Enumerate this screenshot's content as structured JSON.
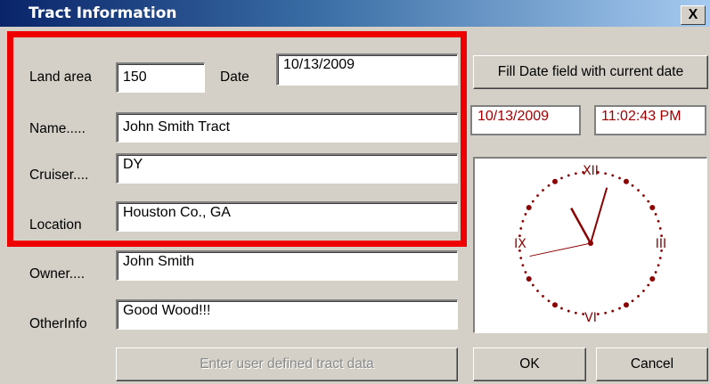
{
  "window": {
    "title": "Tract Information",
    "close_label": "X"
  },
  "form": {
    "land_area": {
      "label": "Land area",
      "value": "150"
    },
    "date": {
      "label": "Date",
      "value": "10/13/2009"
    },
    "name": {
      "label": "Name.....",
      "value": "John Smith Tract"
    },
    "cruiser": {
      "label": "Cruiser....",
      "value": "DY"
    },
    "location": {
      "label": "Location",
      "value": "Houston Co., GA"
    },
    "owner": {
      "label": "Owner....",
      "value": "John Smith"
    },
    "other_info": {
      "label": "OtherInfo",
      "value": "Good Wood!!!"
    }
  },
  "buttons": {
    "fill_date": "Fill Date field with current date",
    "enter_user_defined": "Enter user defined tract data",
    "ok": "OK",
    "cancel": "Cancel"
  },
  "clock": {
    "date": "10/13/2009",
    "time": "11:02:43 PM",
    "numerals": {
      "twelve": "XII",
      "three": "III",
      "six": "VI",
      "nine": "IX"
    },
    "hour": 11,
    "minute": 2,
    "second": 43,
    "color": "#8b0000"
  },
  "annotation": {
    "highlight_color": "#ee0000"
  }
}
